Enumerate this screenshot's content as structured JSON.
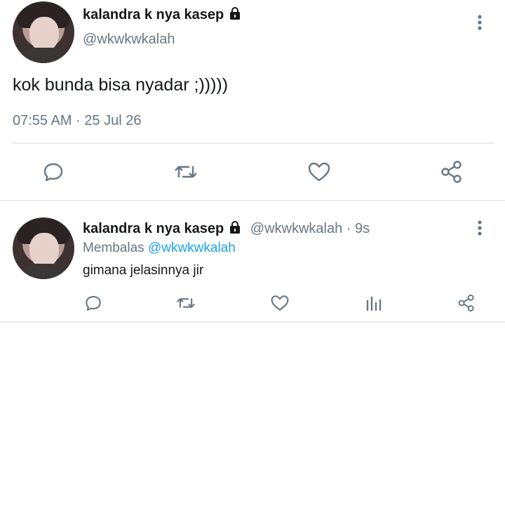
{
  "tweet": {
    "author_name": "kalandra k nya kasep",
    "author_handle": "@wkwkwkalah",
    "text": "kok bunda bisa nyadar ;)))))",
    "timestamp": "07:55 AM · 25 Jul 26",
    "actions": [
      "reply-icon",
      "retweet-icon",
      "like-icon",
      "share-icon"
    ]
  },
  "reply": {
    "author_name": "kalandra k nya kasep",
    "author_handle": "@wkwkwkalah",
    "separator": "·",
    "time_ago": "9s",
    "replying_prefix": "Membalas",
    "replying_to": "@wkwkwkalah",
    "text": "gimana jelasinnya jir",
    "actions": [
      "reply-icon",
      "retweet-icon",
      "like-icon",
      "analytics-icon",
      "share-icon"
    ]
  },
  "colors": {
    "text": "#14171a",
    "secondary": "#657786",
    "link": "#1da1f2",
    "divider": "#e6ecf0",
    "icon": "#657786"
  }
}
